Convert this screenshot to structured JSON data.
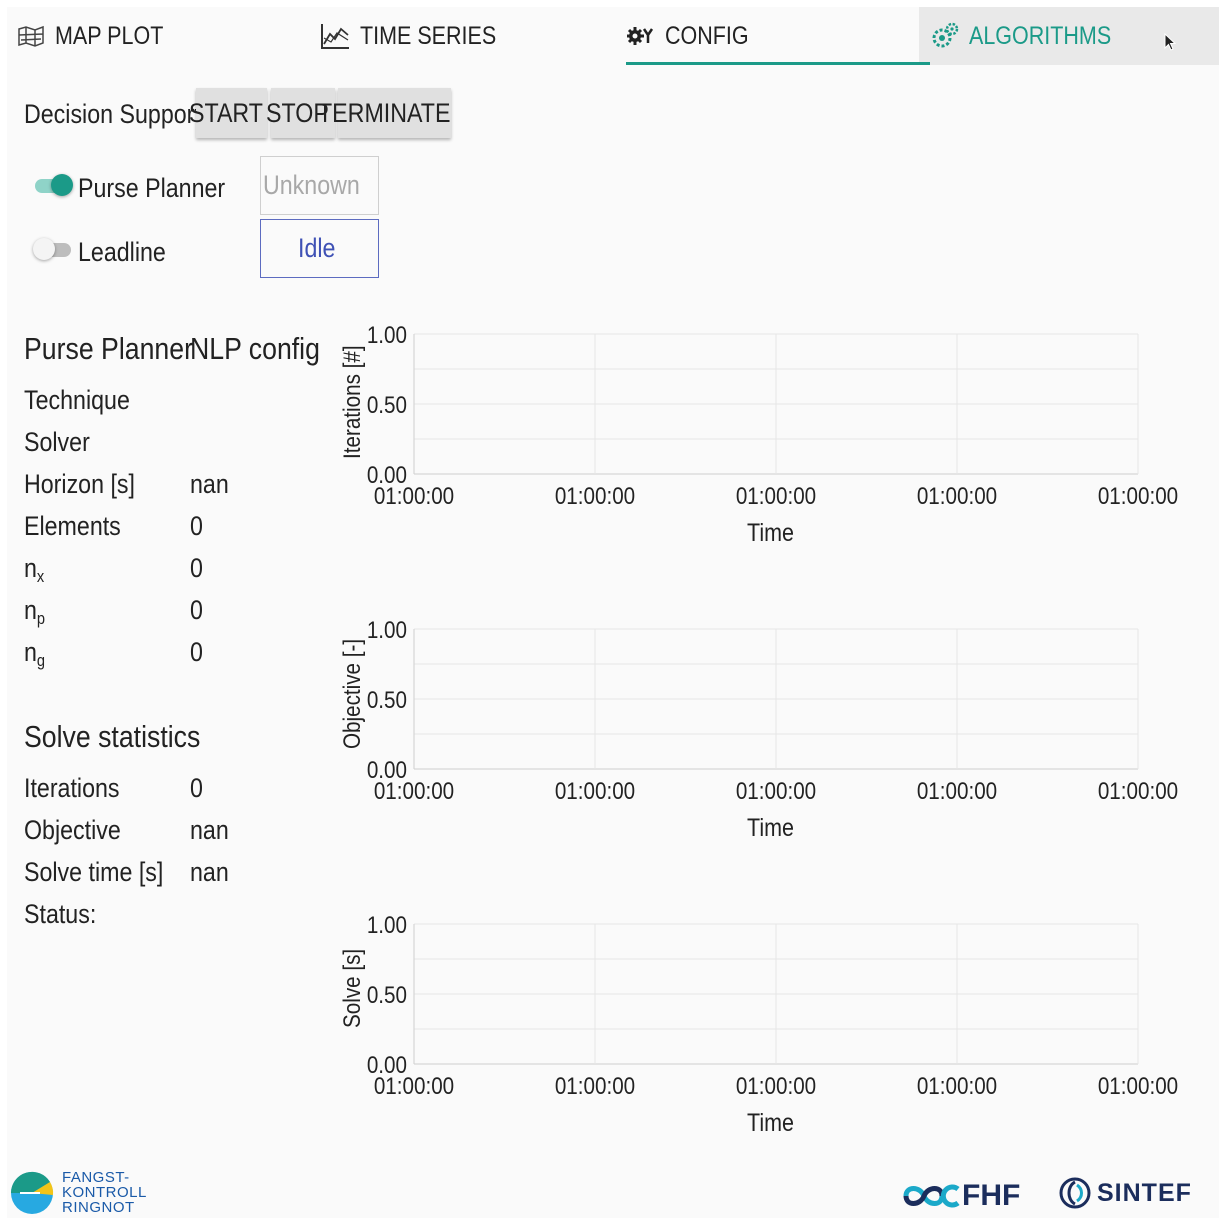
{
  "tabs": [
    {
      "label": "MAP PLOT",
      "icon": "map-icon"
    },
    {
      "label": "TIME SERIES",
      "icon": "line-chart-icon"
    },
    {
      "label": "CONFIG",
      "icon": "gear-icon"
    },
    {
      "label": "ALGORITHMS",
      "icon": "gears-icon"
    }
  ],
  "active_tab": "ALGORITHMS",
  "decision_support": {
    "label": "Decision Support",
    "start": "START",
    "stop": "STOP",
    "terminate": "TERMINATE"
  },
  "algorithms": [
    {
      "label": "Purse Planner",
      "enabled": true,
      "status": "Unknown"
    },
    {
      "label": "Leadline",
      "enabled": false,
      "status": "Idle"
    }
  ],
  "nlp_config": {
    "title_left": "Purse Planner",
    "title_right": "NLP config",
    "rows": [
      {
        "label": "Technique",
        "value": ""
      },
      {
        "label": "Solver",
        "value": ""
      },
      {
        "label": "Horizon [s]",
        "value": "nan"
      },
      {
        "label": "Elements",
        "value": "0"
      },
      {
        "label": "n",
        "sub": "x",
        "value": "0"
      },
      {
        "label": "n",
        "sub": "p",
        "value": "0"
      },
      {
        "label": "n",
        "sub": "g",
        "value": "0"
      }
    ]
  },
  "solve_statistics": {
    "title": "Solve statistics",
    "rows": [
      {
        "label": "Iterations",
        "value": "0"
      },
      {
        "label": "Objective",
        "value": "nan"
      },
      {
        "label": "Solve time [s]",
        "value": "nan"
      },
      {
        "label": "Status:",
        "value": ""
      }
    ]
  },
  "chart_data": [
    {
      "type": "line",
      "ylabel": "Iterations [#]",
      "xlabel": "Time",
      "ylim": [
        0,
        1
      ],
      "yticks": [
        "0.00",
        "0.50",
        "1.00"
      ],
      "xticks": [
        "01:00:00",
        "01:00:00",
        "01:00:00",
        "01:00:00",
        "01:00:00"
      ],
      "series": [],
      "grid": true
    },
    {
      "type": "line",
      "ylabel": "Objective [-]",
      "xlabel": "Time",
      "ylim": [
        0,
        1
      ],
      "yticks": [
        "0.00",
        "0.50",
        "1.00"
      ],
      "xticks": [
        "01:00:00",
        "01:00:00",
        "01:00:00",
        "01:00:00",
        "01:00:00"
      ],
      "series": [],
      "grid": true
    },
    {
      "type": "line",
      "ylabel": "Solve [s]",
      "xlabel": "Time",
      "ylim": [
        0,
        1
      ],
      "yticks": [
        "0.00",
        "0.50",
        "1.00"
      ],
      "xticks": [
        "01:00:00",
        "01:00:00",
        "01:00:00",
        "01:00:00",
        "01:00:00"
      ],
      "series": [],
      "grid": true
    }
  ],
  "footer": {
    "fangst": [
      "FANGST-",
      "KONTROLL",
      "RINGNOT"
    ],
    "fhf": "FHF",
    "sintef": "SINTEF"
  },
  "colors": {
    "accent": "#1b9a88",
    "idle": "#3f51b5",
    "grid": "#e6e6e6"
  }
}
